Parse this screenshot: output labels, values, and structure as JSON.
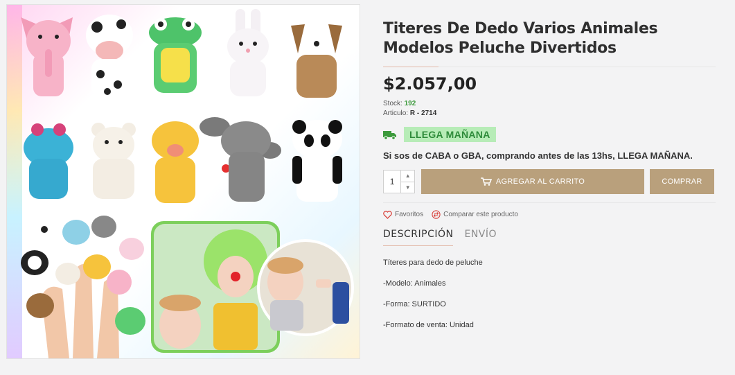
{
  "product": {
    "title_line1": "Titeres De Dedo Varios Animales",
    "title_line2": "Modelos Peluche Divertidos",
    "price": "$2.057,00",
    "stock_label": "Stock:",
    "stock_value": "192",
    "sku_label": "Articulo:",
    "sku_value": "R - 2714"
  },
  "shipping": {
    "badge": "LLEGA MAÑANA",
    "notice": "Si sos de CABA o GBA, comprando antes de las 13hs, LLEGA MAÑANA.",
    "icon": "truck-icon",
    "badge_color": "#b7ecb7"
  },
  "purchase": {
    "quantity": "1",
    "add_to_cart_label": "AGREGAR AL CARRITO",
    "buy_label": "COMPRAR",
    "button_color": "#b9a07c"
  },
  "actions": {
    "favorites_label": "Favoritos",
    "compare_label": "Comparar este producto"
  },
  "tabs": [
    {
      "label": "DESCRIPCIÓN",
      "active": true
    },
    {
      "label": "ENVÍO",
      "active": false
    }
  ],
  "description": [
    "Títeres para dedo de peluche",
    "-Modelo: Animales",
    "-Forma: SURTIDO",
    "-Formato de venta: Unidad"
  ]
}
